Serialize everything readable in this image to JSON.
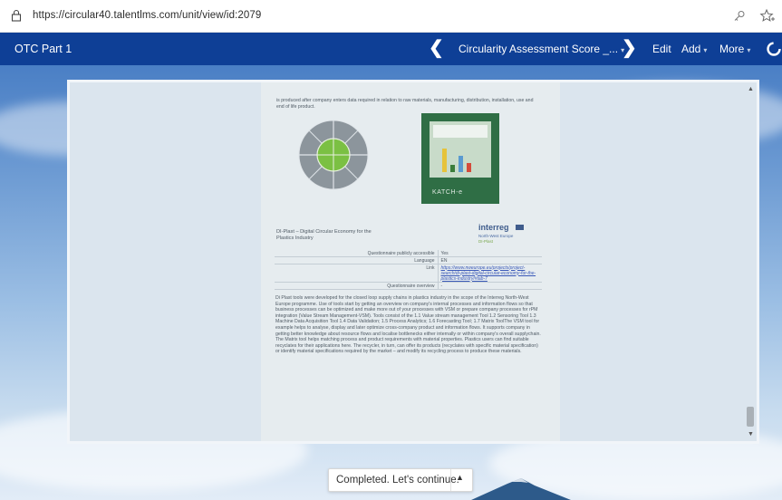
{
  "browser": {
    "url": "https://circular40.talentlms.com/unit/view/id:2079"
  },
  "topbar": {
    "course_title": "OTC Part 1",
    "prev_symbol": "❮",
    "unit_selector": "Circularity Assessment Score _...",
    "next_symbol": "❯",
    "edit_label": "Edit",
    "add_label": "Add",
    "more_label": "More",
    "caret": "▾"
  },
  "document": {
    "intro_text": "is produced after company enters data required in relation to raw materials, manufacturing, distribution, installation, use and end of life product.",
    "cover_brand": "KATCH-e",
    "project_title": "DI-Plast – Digital Circular Economy for the Plastics Industry",
    "logo": {
      "name": "interreg",
      "region": "North-West Europe",
      "project": "DI-Plast"
    },
    "info_rows": [
      {
        "label": "Questionnaire publicly accessible",
        "value": "Yes"
      },
      {
        "label": "Language",
        "value": "EN"
      },
      {
        "label": "Link",
        "value": "https://www.nweurope.eu/projects/project-search/di-plast-digital-circular-economy-for-the-plastics-industry/#tab-7"
      },
      {
        "label": "Questionnaire overview",
        "value": "-"
      }
    ],
    "description": "Di Plast tools were developed for the closed loop supply chains in plastics industry in the scope of the Interreg North-West Europe programme. Use of tools start by getting an overview on company's internal processes and information flows so that business processes can be optimized and make more out of your processes with VSM or prepare company processes for rPM integration (Value Stream Management-VSM). Tools consist of the 1.1 Value stream management Tool 1.2 Sensoring Tool 1.3 Machine Data Acquisition Tool 1.4 Data Validation; 1.5 Process Analytics; 1.6 Forecasting Tool; 1.7 Matrix ToolThe VSM tool for example helps to analyse, display and later optimize cross-company product and information flows. It supports company in getting better knowledge about resource flows and localise bottlenecks either internally or within company's overall supplychain. The Matrix tool helps matching process and product requirements with material properties. Plastics users can find suitable recyclates for their applications here. The recycler, in turn, can offer its products (recyclates with specific material specification) or identify material specifications required by the market – and modify its recycling process to produce these materials."
  },
  "footer": {
    "completed_label": "Completed. Let's continue.",
    "arrow": "▲"
  },
  "colors": {
    "topbar": "#0e3f96",
    "accent_green": "#7bc043",
    "cover_green": "#2f6e45"
  },
  "icons": [
    "lock-icon",
    "key-icon",
    "favorite-icon",
    "chevron-left-icon",
    "chevron-right-icon",
    "spinner-icon",
    "scroll-up-icon",
    "scroll-down-icon",
    "caret-up-icon"
  ]
}
